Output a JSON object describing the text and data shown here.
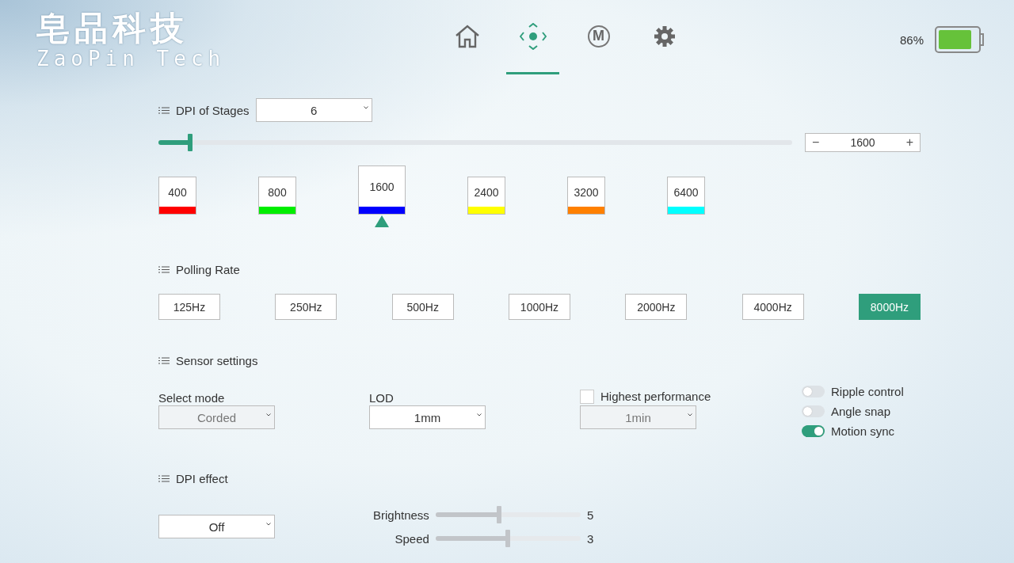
{
  "logo": {
    "title": "皂品科技",
    "subtitle": "ZaoPin Tech"
  },
  "nav": [
    {
      "kind": "home",
      "selected": false
    },
    {
      "kind": "dpi",
      "selected": true
    },
    {
      "kind": "macro",
      "label": "M",
      "selected": false
    },
    {
      "kind": "settings",
      "selected": false
    }
  ],
  "battery": {
    "reading": "86%",
    "level": 0.86
  },
  "dpi": {
    "title": "DPI of Stages",
    "stages_select": "6",
    "level": 0.05,
    "minus": "−",
    "value": "1600",
    "plus": "+",
    "stages": [
      {
        "value": "400",
        "color": "#ff0000",
        "selected": false
      },
      {
        "value": "800",
        "color": "#00ee00",
        "selected": false
      },
      {
        "value": "1600",
        "color": "#0000ff",
        "selected": true
      },
      {
        "value": "2400",
        "color": "#ffff00",
        "selected": false
      },
      {
        "value": "3200",
        "color": "#ff8000",
        "selected": false
      },
      {
        "value": "6400",
        "color": "#00ffff",
        "selected": false
      }
    ]
  },
  "polling": {
    "title": "Polling Rate",
    "rates": [
      {
        "label": "125Hz",
        "selected": false
      },
      {
        "label": "250Hz",
        "selected": false
      },
      {
        "label": "500Hz",
        "selected": false
      },
      {
        "label": "1000Hz",
        "selected": false
      },
      {
        "label": "2000Hz",
        "selected": false
      },
      {
        "label": "4000Hz",
        "selected": false
      },
      {
        "label": "8000Hz",
        "selected": true
      }
    ]
  },
  "sensor": {
    "title": "Sensor settings",
    "mode": {
      "label": "Select mode",
      "value": "Corded",
      "disabled": true
    },
    "lod": {
      "label": "LOD",
      "value": "1mm",
      "disabled": false
    },
    "performance": {
      "label": "Highest performance",
      "checked": false,
      "value": "1min",
      "disabled": true
    },
    "toggles": [
      {
        "label": "Ripple control",
        "on": false
      },
      {
        "label": "Angle snap",
        "on": false
      },
      {
        "label": "Motion sync",
        "on": true
      }
    ]
  },
  "effect": {
    "title": "DPI effect",
    "value": "Off",
    "sliders": [
      {
        "label": "Brightness",
        "level": 0.44,
        "reading": "5"
      },
      {
        "label": "Speed",
        "level": 0.5,
        "reading": "3"
      }
    ]
  }
}
